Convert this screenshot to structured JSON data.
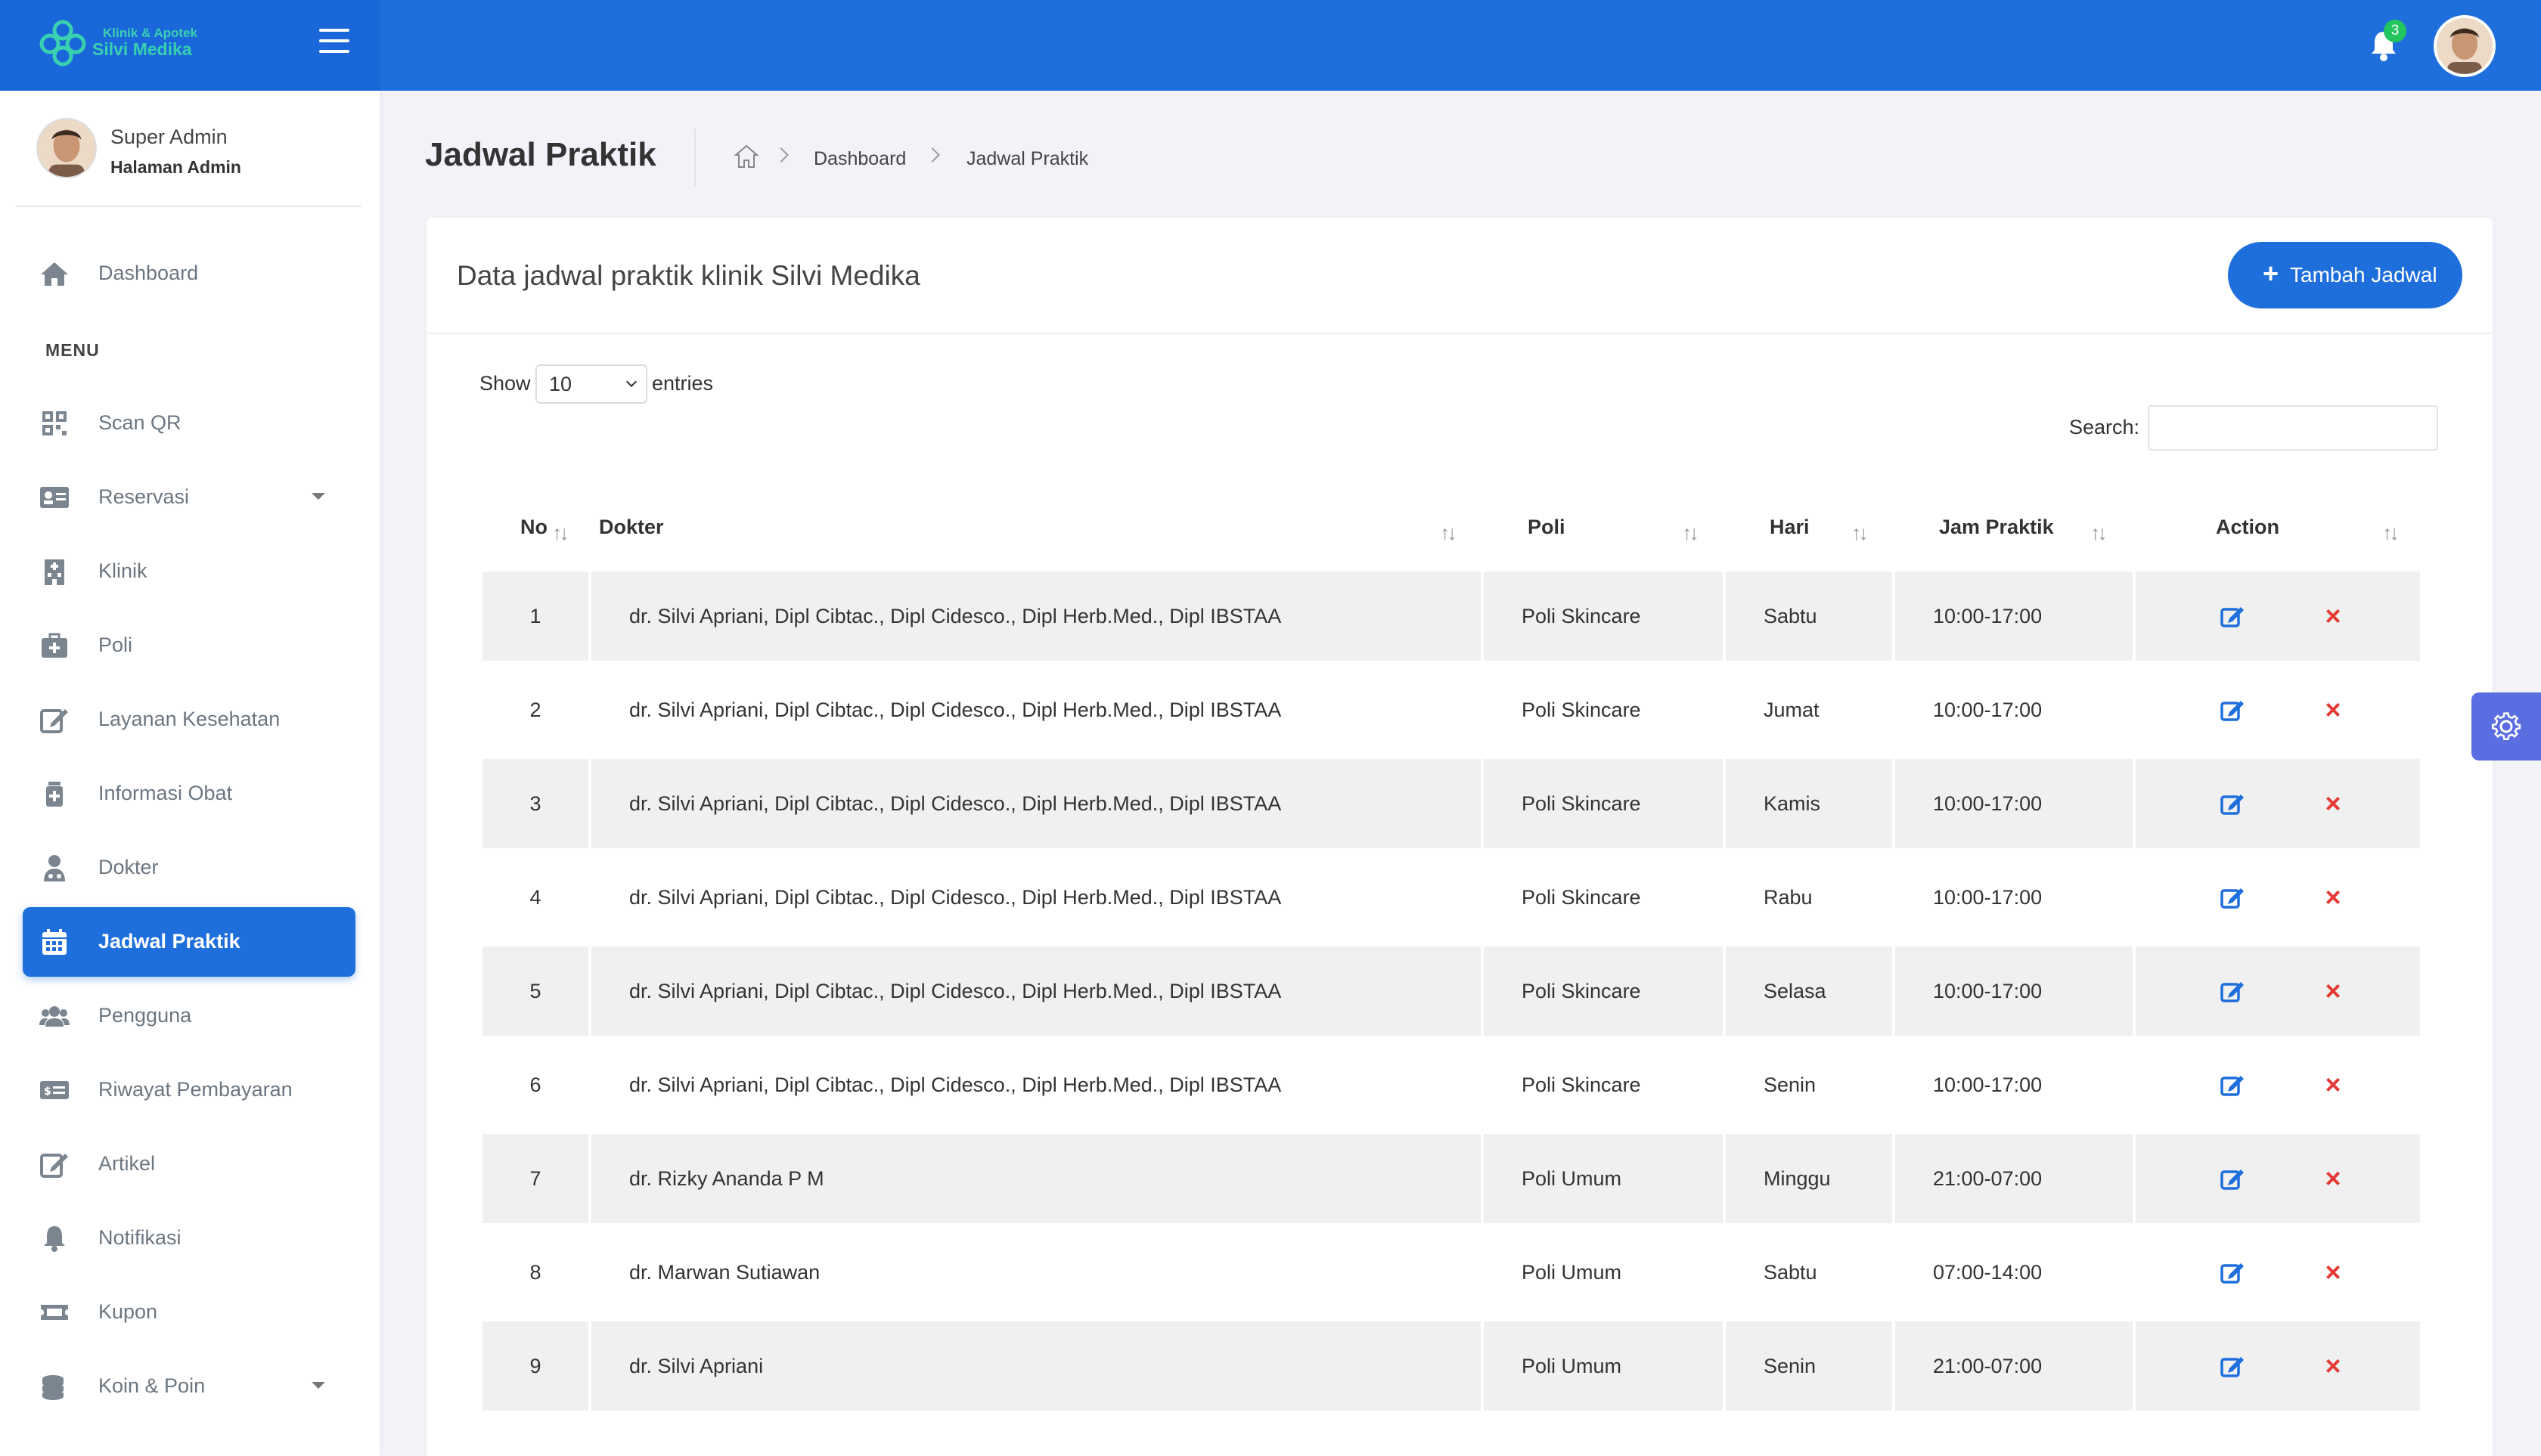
{
  "brand": {
    "sub": "Klinik & Apotek",
    "name": "Silvi Medika"
  },
  "topbar": {
    "notification_count": "3"
  },
  "profile": {
    "name": "Super Admin",
    "role": "Halaman Admin"
  },
  "sidebar": {
    "dashboard": "Dashboard",
    "menu_heading": "MENU",
    "items": [
      {
        "label": "Scan QR"
      },
      {
        "label": "Reservasi"
      },
      {
        "label": "Klinik"
      },
      {
        "label": "Poli"
      },
      {
        "label": "Layanan Kesehatan"
      },
      {
        "label": "Informasi Obat"
      },
      {
        "label": "Dokter"
      },
      {
        "label": "Jadwal Praktik"
      },
      {
        "label": "Pengguna"
      },
      {
        "label": "Riwayat Pembayaran"
      },
      {
        "label": "Artikel"
      },
      {
        "label": "Notifikasi"
      },
      {
        "label": "Kupon"
      },
      {
        "label": "Koin & Poin"
      }
    ]
  },
  "header": {
    "title": "Jadwal Praktik",
    "breadcrumb": [
      "Dashboard",
      "Jadwal Praktik"
    ]
  },
  "card": {
    "title": "Data jadwal praktik klinik Silvi Medika",
    "add_button": "Tambah Jadwal",
    "show_label": "Show",
    "entries_value": "10",
    "entries_label": "entries",
    "search_label": "Search:",
    "search_value": ""
  },
  "table": {
    "columns": [
      "No",
      "Dokter",
      "Poli",
      "Hari",
      "Jam Praktik",
      "Action"
    ],
    "rows": [
      {
        "no": "1",
        "dokter": "dr. Silvi Apriani, Dipl Cibtac., Dipl Cidesco., Dipl Herb.Med., Dipl IBSTAA",
        "poli": "Poli Skincare",
        "hari": "Sabtu",
        "jam": "10:00-17:00"
      },
      {
        "no": "2",
        "dokter": "dr. Silvi Apriani, Dipl Cibtac., Dipl Cidesco., Dipl Herb.Med., Dipl IBSTAA",
        "poli": "Poli Skincare",
        "hari": "Jumat",
        "jam": "10:00-17:00"
      },
      {
        "no": "3",
        "dokter": "dr. Silvi Apriani, Dipl Cibtac., Dipl Cidesco., Dipl Herb.Med., Dipl IBSTAA",
        "poli": "Poli Skincare",
        "hari": "Kamis",
        "jam": "10:00-17:00"
      },
      {
        "no": "4",
        "dokter": "dr. Silvi Apriani, Dipl Cibtac., Dipl Cidesco., Dipl Herb.Med., Dipl IBSTAA",
        "poli": "Poli Skincare",
        "hari": "Rabu",
        "jam": "10:00-17:00"
      },
      {
        "no": "5",
        "dokter": "dr. Silvi Apriani, Dipl Cibtac., Dipl Cidesco., Dipl Herb.Med., Dipl IBSTAA",
        "poli": "Poli Skincare",
        "hari": "Selasa",
        "jam": "10:00-17:00"
      },
      {
        "no": "6",
        "dokter": "dr. Silvi Apriani, Dipl Cibtac., Dipl Cidesco., Dipl Herb.Med., Dipl IBSTAA",
        "poli": "Poli Skincare",
        "hari": "Senin",
        "jam": "10:00-17:00"
      },
      {
        "no": "7",
        "dokter": "dr. Rizky Ananda P M",
        "poli": "Poli Umum",
        "hari": "Minggu",
        "jam": "21:00-07:00"
      },
      {
        "no": "8",
        "dokter": "dr. Marwan Sutiawan",
        "poli": "Poli Umum",
        "hari": "Sabtu",
        "jam": "07:00-14:00"
      },
      {
        "no": "9",
        "dokter": "dr. Silvi Apriani",
        "poli": "Poli Umum",
        "hari": "Senin",
        "jam": "21:00-07:00"
      }
    ]
  },
  "colors": {
    "primary": "#1e6fdc",
    "danger": "#e53935",
    "settings": "#5b6ee1"
  }
}
